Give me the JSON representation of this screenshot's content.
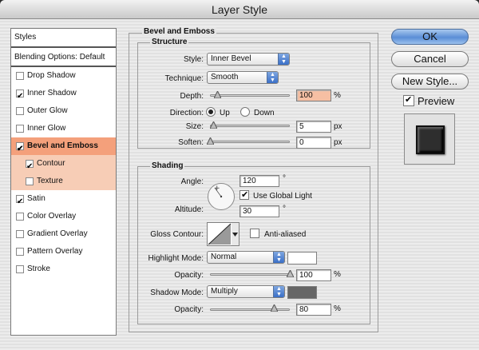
{
  "window": {
    "title": "Layer Style"
  },
  "styles_panel": {
    "header": "Styles",
    "blending": "Blending Options: Default",
    "items": [
      {
        "label": "Drop Shadow",
        "checked": false
      },
      {
        "label": "Inner Shadow",
        "checked": true
      },
      {
        "label": "Outer Glow",
        "checked": false
      },
      {
        "label": "Inner Glow",
        "checked": false
      },
      {
        "label": "Bevel and Emboss",
        "checked": true
      },
      {
        "label": "Contour",
        "checked": true
      },
      {
        "label": "Texture",
        "checked": false
      },
      {
        "label": "Satin",
        "checked": true
      },
      {
        "label": "Color Overlay",
        "checked": false
      },
      {
        "label": "Gradient Overlay",
        "checked": false
      },
      {
        "label": "Pattern Overlay",
        "checked": false
      },
      {
        "label": "Stroke",
        "checked": false
      }
    ]
  },
  "bevel": {
    "title": "Bevel and Emboss",
    "structure": {
      "title": "Structure",
      "style_label": "Style:",
      "style_value": "Inner Bevel",
      "technique_label": "Technique:",
      "technique_value": "Smooth",
      "depth_label": "Depth:",
      "depth_value": "100",
      "depth_unit": "%",
      "direction_label": "Direction:",
      "dir_up": "Up",
      "dir_down": "Down",
      "size_label": "Size:",
      "size_value": "5",
      "size_unit": "px",
      "soften_label": "Soften:",
      "soften_value": "0",
      "soften_unit": "px"
    },
    "shading": {
      "title": "Shading",
      "angle_label": "Angle:",
      "angle_value": "120",
      "deg": "°",
      "global_light": "Use Global Light",
      "altitude_label": "Altitude:",
      "altitude_value": "30",
      "gloss_label": "Gloss Contour:",
      "anti_aliased": "Anti-aliased",
      "highlight_label": "Highlight Mode:",
      "highlight_value": "Normal",
      "highlight_opacity_label": "Opacity:",
      "highlight_opacity": "100",
      "shadow_label": "Shadow Mode:",
      "shadow_value": "Multiply",
      "shadow_opacity_label": "Opacity:",
      "shadow_opacity": "80",
      "pct": "%"
    }
  },
  "buttons": {
    "ok": "OK",
    "cancel": "Cancel",
    "new_style": "New Style...",
    "preview": "Preview"
  },
  "colors": {
    "active": "#f4a07b",
    "sub_active": "#f7cdb6",
    "highlight_swatch": "#ffffff",
    "shadow_swatch": "#666666",
    "depth_field": "#f6bfa3"
  }
}
